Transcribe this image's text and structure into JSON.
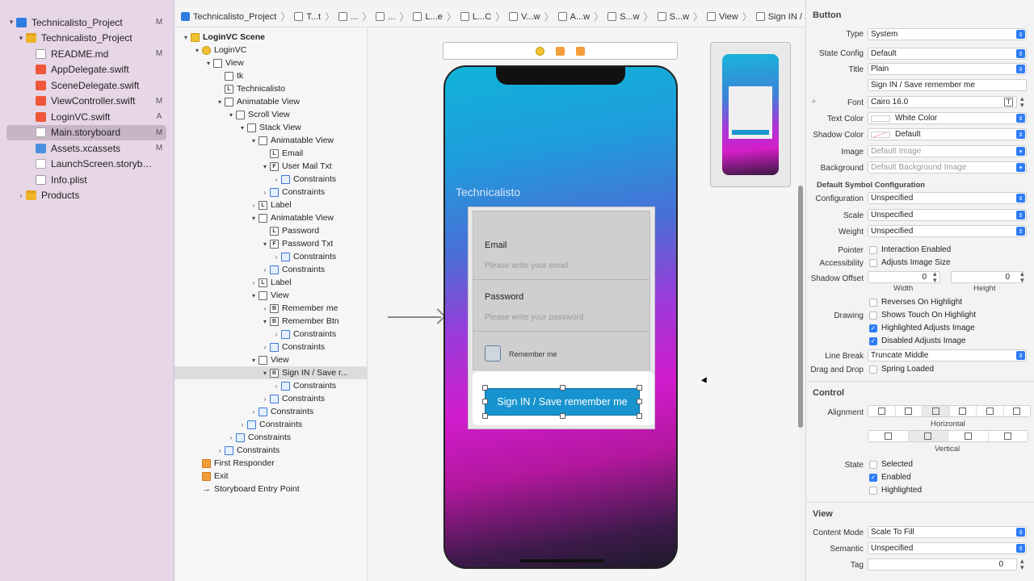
{
  "navigator": {
    "items": [
      {
        "label": "Technicalisto_Project",
        "status": "M",
        "icon": "xcode-project-icon",
        "level": 0,
        "disclosure": "▾"
      },
      {
        "label": "Technicalisto_Project",
        "status": "",
        "icon": "folder-icon",
        "level": 1,
        "disclosure": "▾"
      },
      {
        "label": "README.md",
        "status": "M",
        "icon": "markdown-file-icon",
        "level": 2,
        "disclosure": ""
      },
      {
        "label": "AppDelegate.swift",
        "status": "",
        "icon": "swift-file-icon",
        "level": 2,
        "disclosure": ""
      },
      {
        "label": "SceneDelegate.swift",
        "status": "",
        "icon": "swift-file-icon",
        "level": 2,
        "disclosure": ""
      },
      {
        "label": "ViewController.swift",
        "status": "M",
        "icon": "swift-file-icon",
        "level": 2,
        "disclosure": ""
      },
      {
        "label": "LoginVC.swift",
        "status": "A",
        "icon": "swift-file-icon",
        "level": 2,
        "disclosure": ""
      },
      {
        "label": "Main.storyboard",
        "status": "M",
        "icon": "storyboard-file-icon",
        "level": 2,
        "disclosure": "",
        "selected": true
      },
      {
        "label": "Assets.xcassets",
        "status": "M",
        "icon": "assets-catalog-icon",
        "level": 2,
        "disclosure": ""
      },
      {
        "label": "LaunchScreen.storybo...",
        "status": "",
        "icon": "storyboard-file-icon",
        "level": 2,
        "disclosure": ""
      },
      {
        "label": "Info.plist",
        "status": "",
        "icon": "plist-file-icon",
        "level": 2,
        "disclosure": ""
      },
      {
        "label": "Products",
        "status": "",
        "icon": "folder-icon",
        "level": 1,
        "disclosure": "›"
      }
    ]
  },
  "jumpbar": {
    "crumbs": [
      "Technicalisto_Project",
      "T...t",
      "...",
      "...",
      "L...e",
      "L...C",
      "V...w",
      "A...w",
      "S...w",
      "S...w",
      "View",
      "Sign IN / Save remember me"
    ]
  },
  "outline": {
    "items": [
      {
        "label": "LoginVC Scene",
        "level": 0,
        "icon": "scene",
        "disclosure": "▾",
        "bold": true
      },
      {
        "label": "LoginVC",
        "level": 1,
        "icon": "vc",
        "disclosure": "▾"
      },
      {
        "label": "View",
        "level": 2,
        "icon": "view",
        "disclosure": "▾"
      },
      {
        "label": "tk",
        "level": 3,
        "icon": "img",
        "disclosure": ""
      },
      {
        "label": "Technicalisto",
        "level": 3,
        "icon": "L",
        "disclosure": ""
      },
      {
        "label": "Animatable View",
        "level": 3,
        "icon": "view",
        "disclosure": "▾"
      },
      {
        "label": "Scroll View",
        "level": 4,
        "icon": "view",
        "disclosure": "▾"
      },
      {
        "label": "Stack View",
        "level": 5,
        "icon": "stk",
        "disclosure": "▾"
      },
      {
        "label": "Animatable View",
        "level": 6,
        "icon": "view",
        "disclosure": "▾"
      },
      {
        "label": "Email",
        "level": 7,
        "icon": "L",
        "disclosure": ""
      },
      {
        "label": "User Mail Txt",
        "level": 7,
        "icon": "F",
        "disclosure": "▾"
      },
      {
        "label": "Constraints",
        "level": 8,
        "icon": "cons",
        "disclosure": "›"
      },
      {
        "label": "Constraints",
        "level": 7,
        "icon": "cons",
        "disclosure": "›"
      },
      {
        "label": "Label",
        "level": 6,
        "icon": "L",
        "disclosure": "›"
      },
      {
        "label": "Animatable View",
        "level": 6,
        "icon": "view",
        "disclosure": "▾"
      },
      {
        "label": "Password",
        "level": 7,
        "icon": "L",
        "disclosure": ""
      },
      {
        "label": "Password Txt",
        "level": 7,
        "icon": "F",
        "disclosure": "▾"
      },
      {
        "label": "Constraints",
        "level": 8,
        "icon": "cons",
        "disclosure": "›"
      },
      {
        "label": "Constraints",
        "level": 7,
        "icon": "cons",
        "disclosure": "›"
      },
      {
        "label": "Label",
        "level": 6,
        "icon": "L",
        "disclosure": "›"
      },
      {
        "label": "View",
        "level": 6,
        "icon": "view",
        "disclosure": "▾"
      },
      {
        "label": "Remember me",
        "level": 7,
        "icon": "B",
        "disclosure": "›"
      },
      {
        "label": "Remember Btn",
        "level": 7,
        "icon": "B",
        "disclosure": "▾"
      },
      {
        "label": "Constraints",
        "level": 8,
        "icon": "cons",
        "disclosure": "›"
      },
      {
        "label": "Constraints",
        "level": 7,
        "icon": "cons",
        "disclosure": "›"
      },
      {
        "label": "View",
        "level": 6,
        "icon": "view",
        "disclosure": "▾"
      },
      {
        "label": "Sign IN / Save r...",
        "level": 7,
        "icon": "B",
        "disclosure": "▾",
        "selected": true
      },
      {
        "label": "Constraints",
        "level": 8,
        "icon": "cons",
        "disclosure": "›"
      },
      {
        "label": "Constraints",
        "level": 7,
        "icon": "cons",
        "disclosure": "›"
      },
      {
        "label": "Constraints",
        "level": 6,
        "icon": "cons",
        "disclosure": "›"
      },
      {
        "label": "Constraints",
        "level": 5,
        "icon": "cons",
        "disclosure": "›"
      },
      {
        "label": "Constraints",
        "level": 4,
        "icon": "cons",
        "disclosure": "›"
      },
      {
        "label": "Constraints",
        "level": 3,
        "icon": "cons",
        "disclosure": "›"
      },
      {
        "label": "First Responder",
        "level": 1,
        "icon": "fr",
        "disclosure": ""
      },
      {
        "label": "Exit",
        "level": 1,
        "icon": "exit",
        "disclosure": ""
      },
      {
        "label": "Storyboard Entry Point",
        "level": 1,
        "icon": "entry",
        "disclosure": ""
      }
    ]
  },
  "canvas": {
    "app_title": "Technicalisto",
    "email_label": "Email",
    "email_placeholder": "Please write your email",
    "password_label": "Password",
    "password_placeholder": "Please write your password",
    "remember_label": "Remember me",
    "signin_label": "Sign IN / Save remember me"
  },
  "inspector": {
    "button_section": "Button",
    "type_label": "Type",
    "type_value": "System",
    "state_config_label": "State Config",
    "state_config_value": "Default",
    "title_label": "Title",
    "title_value": "Plain",
    "title_text": "Sign IN / Save remember me",
    "font_label": "Font",
    "font_value": "Cairo 16.0",
    "text_color_label": "Text Color",
    "text_color_value": "White Color",
    "shadow_color_label": "Shadow Color",
    "shadow_color_value": "Default",
    "image_label": "Image",
    "image_placeholder": "Default Image",
    "background_label": "Background",
    "background_placeholder": "Default Background Image",
    "symbol_config_title": "Default Symbol Configuration",
    "configuration_label": "Configuration",
    "configuration_value": "Unspecified",
    "scale_label": "Scale",
    "scale_value": "Unspecified",
    "weight_label": "Weight",
    "weight_value": "Unspecified",
    "pointer_label": "Pointer",
    "pointer_cb": "Interaction Enabled",
    "accessibility_label": "Accessibility",
    "accessibility_cb": "Adjusts Image Size",
    "shadow_offset_label": "Shadow Offset",
    "shadow_width": "0",
    "shadow_height": "0",
    "width_label": "Width",
    "height_label": "Height",
    "reverses_cb": "Reverses On Highlight",
    "drawing_label": "Drawing",
    "shows_touch_cb": "Shows Touch On Highlight",
    "highlighted_adjusts_cb": "Highlighted Adjusts Image",
    "disabled_adjusts_cb": "Disabled Adjusts Image",
    "line_break_label": "Line Break",
    "line_break_value": "Truncate Middle",
    "drag_drop_label": "Drag and Drop",
    "spring_loaded_cb": "Spring Loaded",
    "control_section": "Control",
    "alignment_label": "Alignment",
    "horizontal_label": "Horizontal",
    "vertical_label": "Vertical",
    "state_label": "State",
    "selected_cb": "Selected",
    "enabled_cb": "Enabled",
    "highlighted_cb": "Highlighted",
    "view_section": "View",
    "content_mode_label": "Content Mode",
    "content_mode_value": "Scale To Fill",
    "semantic_label": "Semantic",
    "semantic_value": "Unspecified",
    "tag_label": "Tag",
    "tag_value": "0",
    "accent_color": "#2e7cf6"
  }
}
